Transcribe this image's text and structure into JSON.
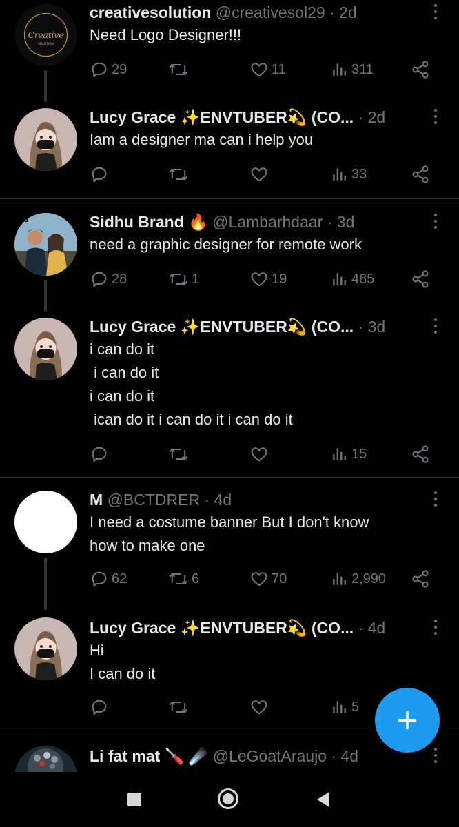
{
  "tweets": [
    {
      "name": "creativesolution",
      "emoji": "",
      "handle": "@creativesol29",
      "time": "2d",
      "body": "Need Logo Designer!!!",
      "reply": "29",
      "retweet": "",
      "like": "11",
      "views": "311",
      "avatar": "logo",
      "avatar_text": "Creative",
      "avatar_sub": "SOLUTION"
    },
    {
      "name": "Lucy Grace ✨ENVTUBER💫 (CO...",
      "emoji": "",
      "handle": "",
      "time": "2d",
      "body": "Iam a designer ma can i help you",
      "reply": "",
      "retweet": "",
      "like": "",
      "views": "33",
      "avatar": "lucy"
    },
    {
      "name": "Sidhu Brand",
      "emoji": "🔥",
      "handle": "@Lambarhdaar",
      "time": "3d",
      "body": "need a graphic designer for remote work",
      "reply": "28",
      "retweet": "1",
      "like": "19",
      "views": "485",
      "avatar": "sidhu",
      "avatar_text": "Rip"
    },
    {
      "name": "Lucy Grace ✨ENVTUBER💫 (CO...",
      "emoji": "",
      "handle": "",
      "time": "3d",
      "body": "i can do it\n i can do it\ni can do it\n ican do it i can do it i can do it",
      "reply": "",
      "retweet": "",
      "like": "",
      "views": "15",
      "avatar": "lucy"
    },
    {
      "name": "M",
      "emoji": "",
      "handle": "@BCTDRER",
      "time": "4d",
      "body": "I need a costume banner But I don't know\nhow to make one",
      "reply": "62",
      "retweet": "6",
      "like": "70",
      "views": "2,990",
      "avatar": "white"
    },
    {
      "name": "Lucy Grace ✨ENVTUBER💫 (CO...",
      "emoji": "",
      "handle": "",
      "time": "4d",
      "body": "Hi\nI can do it",
      "reply": "",
      "retweet": "",
      "like": "",
      "views": "5",
      "avatar": "lucy"
    },
    {
      "name": "Li fat mat",
      "emoji": "🪛 ☄️",
      "handle": "@LeGoatAraujo",
      "time": "4d",
      "body": "",
      "reply": "",
      "retweet": "",
      "like": "",
      "views": "",
      "avatar": "person"
    }
  ],
  "fab_icon": "plus-icon",
  "nav": {
    "buttons": [
      "recents-button",
      "home-button",
      "back-button"
    ]
  },
  "colors": {
    "accent": "#1d9bf0",
    "muted": "#71767b",
    "text": "#e7e9ea",
    "bg": "#000000"
  }
}
